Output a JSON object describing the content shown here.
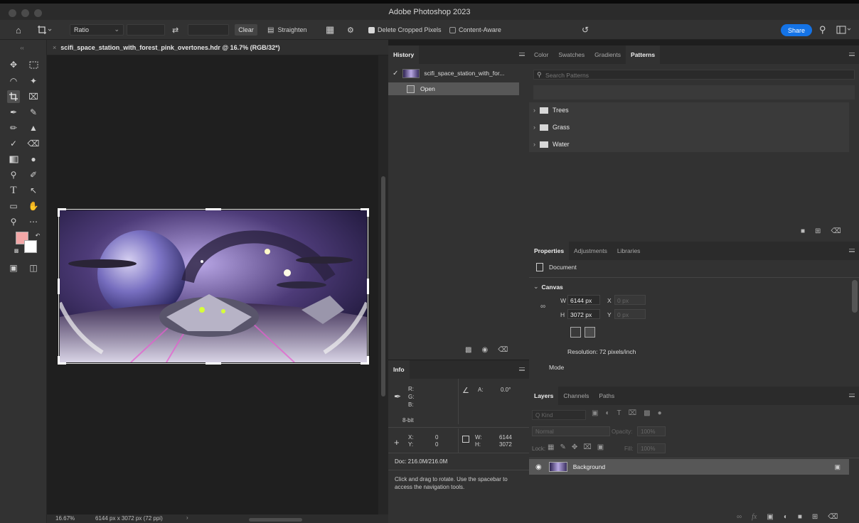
{
  "app": {
    "title": "Adobe Photoshop 2023"
  },
  "options_bar": {
    "ratio_label": "Ratio",
    "clear_label": "Clear",
    "straighten_label": "Straighten",
    "delete_cropped_label": "Delete Cropped Pixels",
    "content_aware_label": "Content-Aware",
    "share_label": "Share"
  },
  "document": {
    "tab_title": "scifi_space_station_with_forest_pink_overtones.hdr @ 16.7% (RGB/32*)",
    "zoom": "16.67%",
    "dimensions": "6144 px x 3072 px (72 ppi)"
  },
  "history": {
    "title": "History",
    "snapshot_name": "scifi_space_station_with_for...",
    "step": "Open"
  },
  "info": {
    "title": "Info",
    "r_label": "R:",
    "g_label": "G:",
    "b_label": "B:",
    "bit_depth": "8-bit",
    "angle_label": "A:",
    "angle_value": "0.0°",
    "x_label": "X:",
    "x_value": "0",
    "y_label": "Y:",
    "y_value": "0",
    "w_label": "W:",
    "w_value": "6144",
    "h_label": "H:",
    "h_value": "3072",
    "doc_size": "Doc: 216.0M/216.0M",
    "hint": "Click and drag to rotate. Use the spacebar to access the navigation tools."
  },
  "patterns": {
    "tabs": [
      "Color",
      "Swatches",
      "Gradients",
      "Patterns"
    ],
    "search_placeholder": "Search Patterns",
    "groups": [
      "Trees",
      "Grass",
      "Water"
    ]
  },
  "properties": {
    "tabs": [
      "Properties",
      "Adjustments",
      "Libraries"
    ],
    "type_label": "Document",
    "section_label": "Canvas",
    "w_label": "W",
    "w_value": "6144 px",
    "h_label": "H",
    "h_value": "3072 px",
    "x_label": "X",
    "x_placeholder": "0 px",
    "y_label": "Y",
    "y_placeholder": "0 px",
    "resolution": "Resolution: 72 pixels/inch",
    "mode_label": "Mode"
  },
  "layers": {
    "tabs": [
      "Layers",
      "Channels",
      "Paths"
    ],
    "kind_placeholder": "Q Kind",
    "blend_mode": "Normal",
    "opacity_label": "Opacity:",
    "opacity_value": "100%",
    "lock_label": "Lock:",
    "fill_label": "Fill:",
    "fill_value": "100%",
    "layer_name": "Background"
  },
  "colors": {
    "foreground": "#f2a7a7",
    "background": "#ffffff",
    "accent": "#1473e6"
  }
}
